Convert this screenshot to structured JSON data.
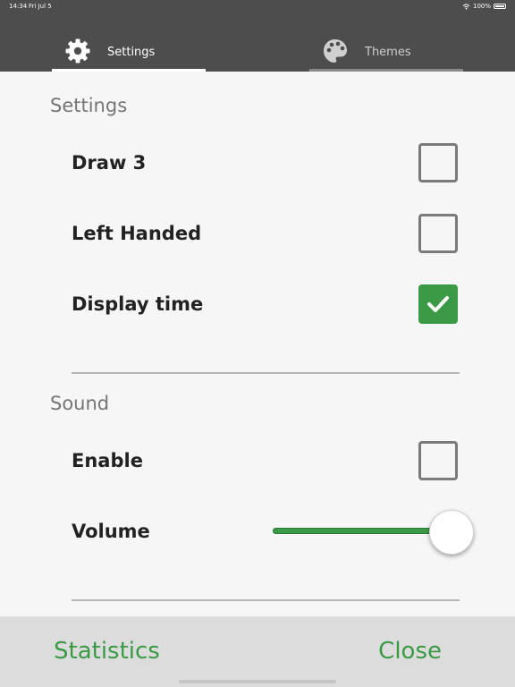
{
  "status_bar": {
    "time": "14:34",
    "date": "Fri Jul 5",
    "battery": "100%",
    "battery_level": 1.0,
    "icons": [
      "wifi-icon",
      "battery-icon"
    ]
  },
  "tabs": [
    {
      "label": "Settings",
      "icon": "gear-icon",
      "selected": true
    },
    {
      "label": "Themes",
      "icon": "palette-icon",
      "selected": false
    }
  ],
  "sections": {
    "settings": {
      "title": "Settings",
      "rows": [
        {
          "label": "Draw 3",
          "checked": false
        },
        {
          "label": "Left Handed",
          "checked": false
        },
        {
          "label": "Display time",
          "checked": true
        }
      ]
    },
    "sound": {
      "title": "Sound",
      "enable": {
        "label": "Enable",
        "checked": false
      },
      "volume": {
        "label": "Volume",
        "value": 1.0
      }
    }
  },
  "footer": {
    "statistics": "Statistics",
    "close": "Close"
  },
  "colors": {
    "header": "#4d4d4d",
    "accent": "#3b9a46",
    "background": "#f6f6f6",
    "footer": "#dcdcdc"
  }
}
